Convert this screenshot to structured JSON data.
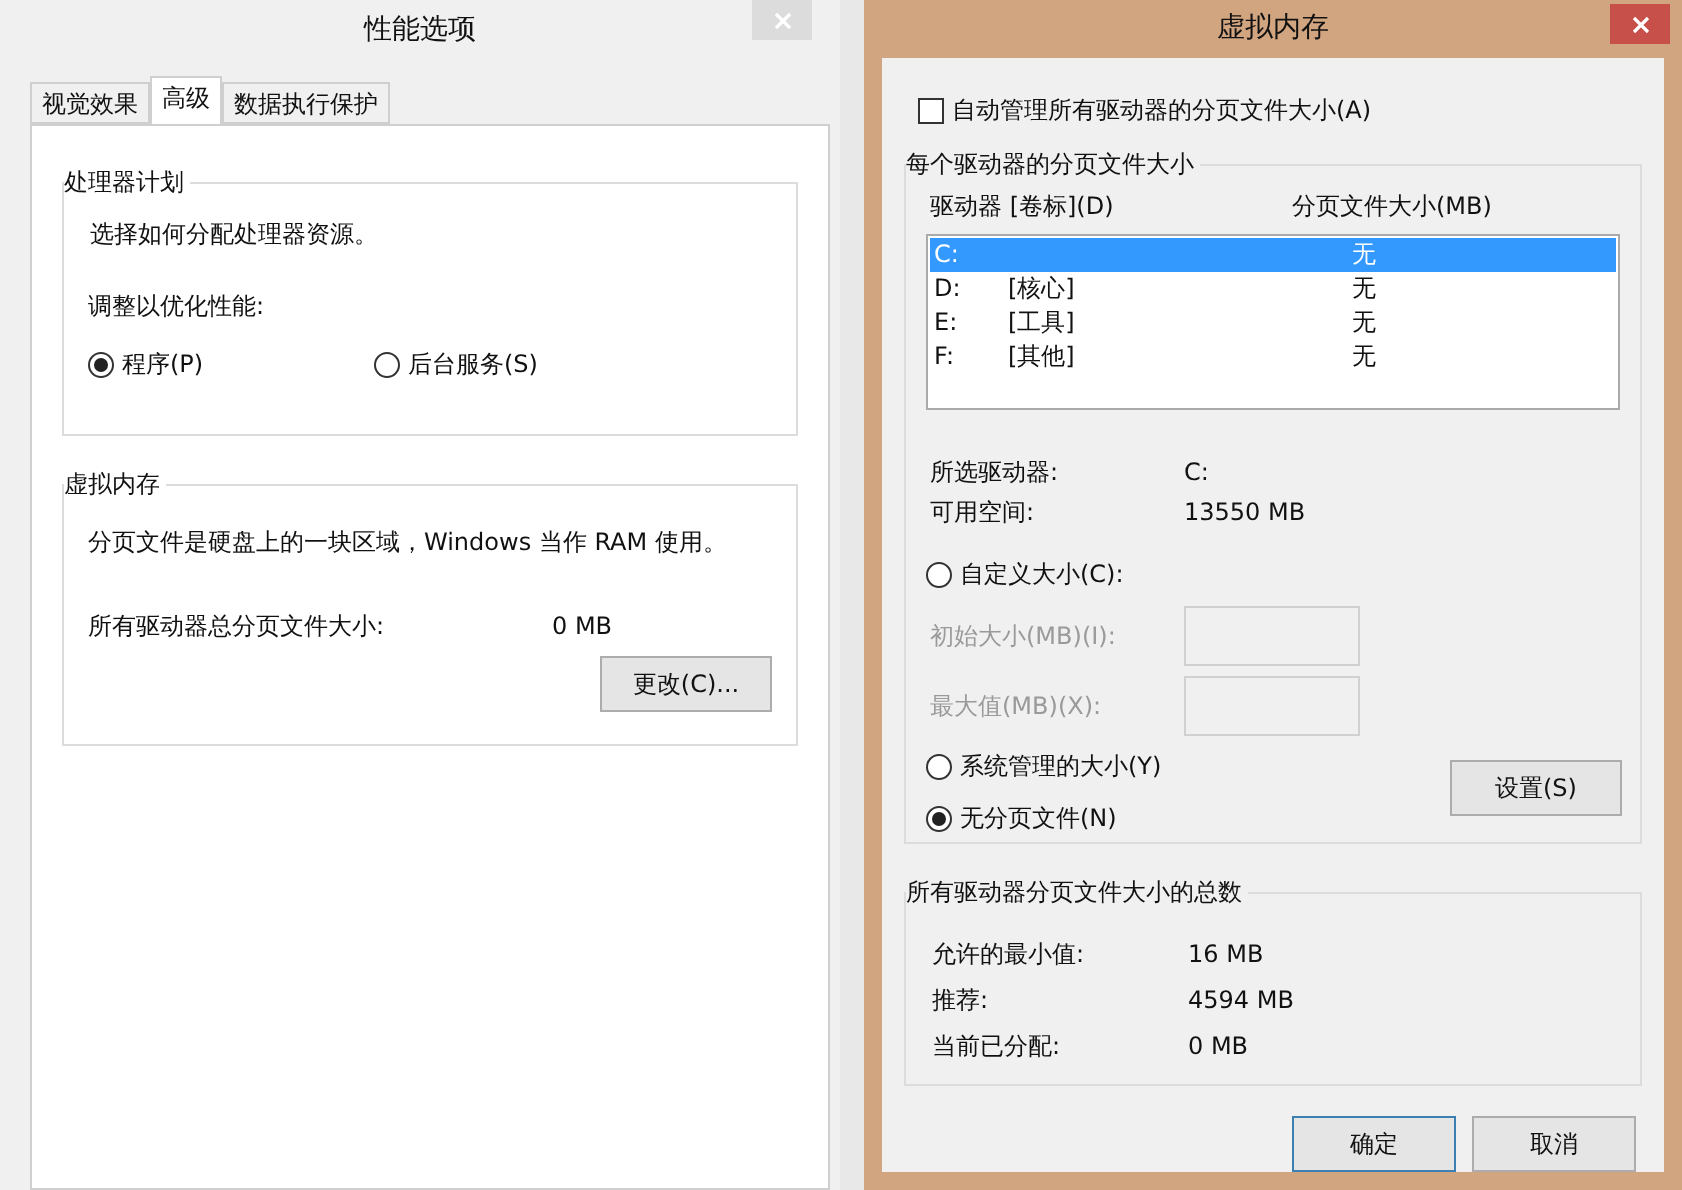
{
  "perf_window": {
    "title": "性能选项",
    "tabs": [
      {
        "label": "视觉效果",
        "selected": false
      },
      {
        "label": "高级",
        "selected": true
      },
      {
        "label": "数据执行保护",
        "selected": false
      }
    ],
    "processor": {
      "title": "处理器计划",
      "description": "选择如何分配处理器资源。",
      "adjust_label": "调整以优化性能:",
      "options": [
        {
          "label": "程序(P)",
          "selected": true
        },
        {
          "label": "后台服务(S)",
          "selected": false
        }
      ]
    },
    "virtual_memory": {
      "title": "虚拟内存",
      "description": "分页文件是硬盘上的一块区域，Windows 当作 RAM 使用。",
      "total_label": "所有驱动器总分页文件大小:",
      "total_value": "0 MB",
      "change_button": "更改(C)..."
    }
  },
  "vm_window": {
    "title": "虚拟内存",
    "auto_manage": {
      "label": "自动管理所有驱动器的分页文件大小(A)",
      "checked": false
    },
    "per_drive": {
      "title": "每个驱动器的分页文件大小",
      "columns": [
        "驱动器 [卷标](D)",
        "分页文件大小(MB)"
      ],
      "drives": [
        {
          "drive": "C:",
          "size": "无",
          "selected": true
        },
        {
          "drive": "D:",
          "label": "[核心]",
          "size": "无",
          "selected": false
        },
        {
          "drive": "E:",
          "label": "[工具]",
          "size": "无",
          "selected": false
        },
        {
          "drive": "F:",
          "label": "[其他]",
          "size": "无",
          "selected": false
        }
      ],
      "selected_drive_label": "所选驱动器:",
      "selected_drive_value": "C:",
      "free_label": "可用空间:",
      "free_value": "13550 MB",
      "options": [
        {
          "kind": "radio",
          "label": "自定义大小(C):",
          "selected": false
        },
        {
          "kind": "field",
          "label": "初始大小(MB)(I):",
          "disabled": true
        },
        {
          "kind": "field",
          "label": "最大值(MB)(X):",
          "disabled": true
        },
        {
          "kind": "radio",
          "label": "系统管理的大小(Y)",
          "selected": false
        },
        {
          "kind": "radio",
          "label": "无分页文件(N)",
          "selected": true
        }
      ],
      "set_button": "设置(S)"
    },
    "totals": {
      "title": "所有驱动器分页文件大小的总数",
      "rows": [
        {
          "label": "允许的最小值:",
          "value": "16 MB"
        },
        {
          "label": "推荐:",
          "value": "4594 MB"
        },
        {
          "label": "当前已分配:",
          "value": "0 MB"
        }
      ]
    },
    "buttons": [
      "确定",
      "取消"
    ]
  }
}
